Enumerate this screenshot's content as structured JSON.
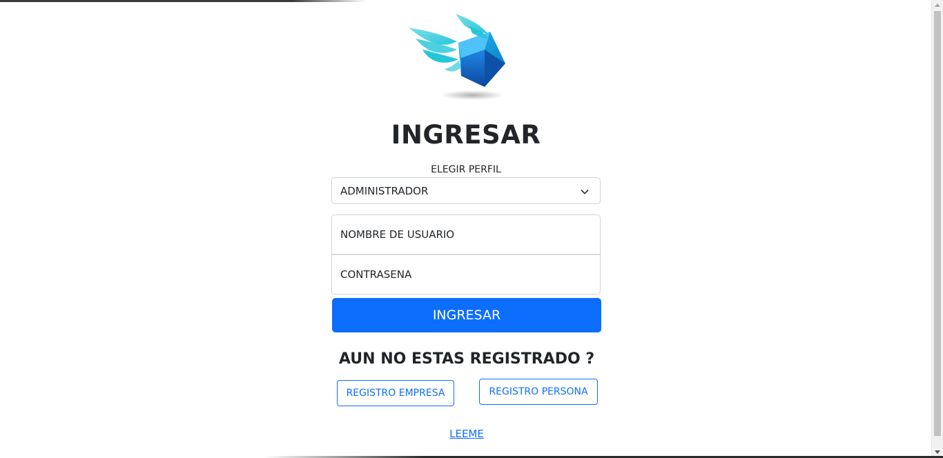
{
  "login": {
    "title": "INGRESAR",
    "profile_label": "ELEGIR PERFIL",
    "profile_selected": "ADMINISTRADOR",
    "username_placeholder": "NOMBRE DE USUARIO",
    "password_placeholder": "CONTRASENA",
    "submit_label": "INGRESAR"
  },
  "register": {
    "question": "AUN NO ESTAS REGISTRADO ?",
    "company_label": "REGISTRO EMPRESA",
    "person_label": "REGISTRO PERSONA"
  },
  "footer": {
    "readme_label": "LEEME"
  },
  "colors": {
    "primary": "#0d6efd",
    "text": "#212529",
    "border": "#ced4da",
    "logo_blue": "#1e88e5",
    "logo_cyan": "#4dd0e1"
  },
  "icons": {
    "logo": "winged-box-logo",
    "select_arrow": "chevron-down-icon"
  }
}
